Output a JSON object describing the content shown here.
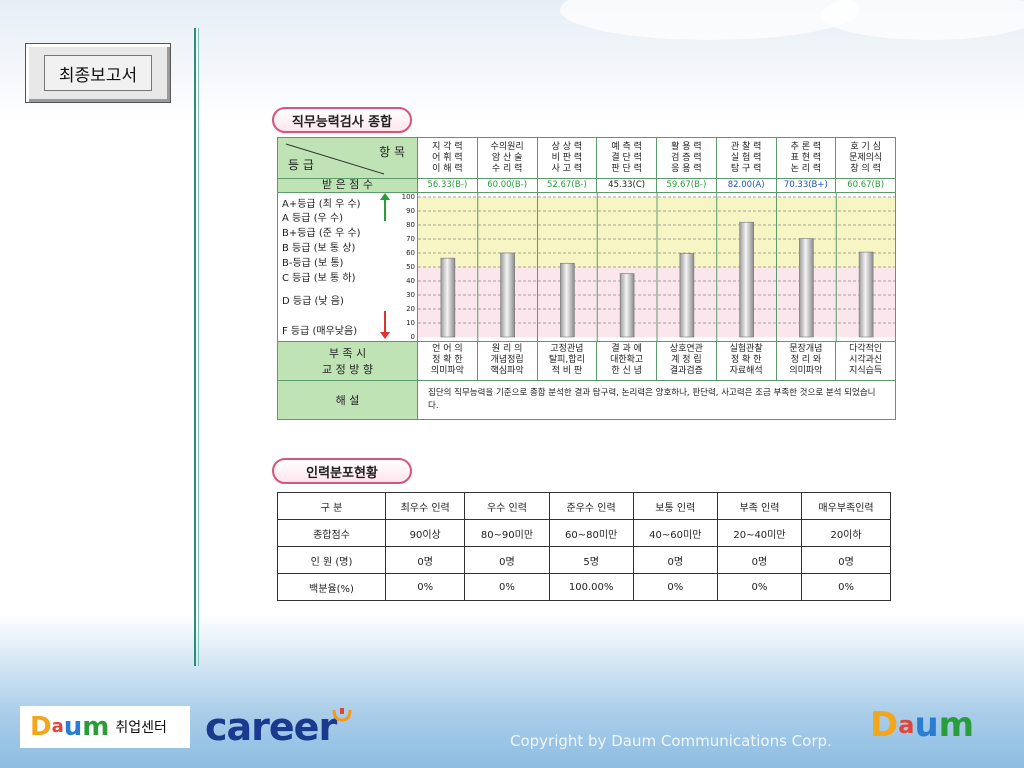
{
  "sidebar": {
    "report_button": "최종보고서"
  },
  "aptitude": {
    "title": "직무능력검사 종합",
    "header_item": "항 목",
    "header_grade": "등 급",
    "score_label": "받 은 점 수",
    "columns": [
      {
        "lines": [
          "지 각 력",
          "어 휘 력",
          "이 해 력"
        ],
        "score_text": "56.33(B-)",
        "score_color": "#2a9c3a",
        "value": 56.33
      },
      {
        "lines": [
          "수의원리",
          "암 산 술",
          "수 리 력"
        ],
        "score_text": "60.00(B-)",
        "score_color": "#2a9c3a",
        "value": 60.0
      },
      {
        "lines": [
          "상 상 력",
          "비 판 력",
          "사 고 력"
        ],
        "score_text": "52.67(B-)",
        "score_color": "#2a9c3a",
        "value": 52.67
      },
      {
        "lines": [
          "예 측 력",
          "결 단 력",
          "판 단 력"
        ],
        "score_text": "45.33(C)",
        "score_color": "#222222",
        "value": 45.33
      },
      {
        "lines": [
          "활 용 력",
          "검 증 력",
          "응 용 력"
        ],
        "score_text": "59.67(B-)",
        "score_color": "#2a9c3a",
        "value": 59.67
      },
      {
        "lines": [
          "관 찰 력",
          "실 험 력",
          "탐 구 력"
        ],
        "score_text": "82.00(A)",
        "score_color": "#1f4fbf",
        "value": 82.0
      },
      {
        "lines": [
          "추 론 력",
          "표 현 력",
          "논 리 력"
        ],
        "score_text": "70.33(B+)",
        "score_color": "#1f4fbf",
        "value": 70.33
      },
      {
        "lines": [
          "호 기 심",
          "문제의식",
          "창 의 력"
        ],
        "score_text": "60.67(B)",
        "score_color": "#2a9c3a",
        "value": 60.67
      }
    ],
    "grades": [
      {
        "label": "A+등급 (최 우 수)",
        "top": 2
      },
      {
        "label": "A 등급 (우     수)",
        "top": 16
      },
      {
        "label": "B+등급 (준 우 수)",
        "top": 31
      },
      {
        "label": "B 등급 (보 통 상)",
        "top": 46
      },
      {
        "label": "B-등급 (보     통)",
        "top": 61
      },
      {
        "label": "C 등급 (보 통 하)",
        "top": 76
      },
      {
        "label": "D 등급 (낮     음)",
        "top": 99
      },
      {
        "label": "F 등급 (매우낮음)",
        "top": 129
      }
    ],
    "ticks": [
      "100",
      "90",
      "80",
      "70",
      "60",
      "50",
      "40",
      "30",
      "20",
      "10",
      "0"
    ],
    "weakness": {
      "label_line1": "부   족   시",
      "label_line2": "교 정 방 향",
      "cells": [
        [
          "언 어 의",
          "정 확 한",
          "의미파악"
        ],
        [
          "원 리 의",
          "개념정립",
          "핵심파악"
        ],
        [
          "고정관념",
          "탈피,합리",
          "적 비 판"
        ],
        [
          "결 과 에",
          "대한확고",
          "한 신 념"
        ],
        [
          "상호연관",
          "계 정 립",
          "결과검증"
        ],
        [
          "실험관찰",
          "정 확 한",
          "자료해석"
        ],
        [
          "문장개념",
          "정 리 와",
          "의미파악"
        ],
        [
          "다각적인",
          "시각과신",
          "지식습득"
        ]
      ]
    },
    "commentary": {
      "label": "해          설",
      "text": "집단의 직무능력을 기준으로 종합 분석한 결과 탐구력, 논리력은 양호하나, 판단력, 사고력은 조금 부족한 것으로 분석 되었습니다."
    }
  },
  "chart_data": {
    "type": "bar",
    "categories": [
      "지각력·어휘력·이해력",
      "수의원리·암산술·수리력",
      "상상력·비판력·사고력",
      "예측력·결단력·판단력",
      "활용력·검증력·응용력",
      "관찰력·실험력·탐구력",
      "추론력·표현력·논리력",
      "호기심·문제의식·창의력"
    ],
    "values": [
      56.33,
      60.0,
      52.67,
      45.33,
      59.67,
      82.0,
      70.33,
      60.67
    ],
    "ylim": [
      0,
      100
    ],
    "grid": true,
    "bands": [
      {
        "from": 50,
        "to": 100,
        "color": "#f7f5c4"
      },
      {
        "from": 0,
        "to": 50,
        "color": "#fbe6ee"
      }
    ]
  },
  "distribution": {
    "title": "인력분포현황",
    "header": [
      "구  분",
      "최우수 인력",
      "우수 인력",
      "준우수 인력",
      "보통 인력",
      "부족 인력",
      "매우부족인력"
    ],
    "rows": [
      [
        "종합점수",
        "90이상",
        "80~90미만",
        "60~80미만",
        "40~60미만",
        "20~40미만",
        "20이하"
      ],
      [
        "인 원 (명)",
        "0명",
        "0명",
        "5명",
        "0명",
        "0명",
        "0명"
      ],
      [
        "백분율(%)",
        "0%",
        "0%",
        "100.00%",
        "0%",
        "0%",
        "0%"
      ]
    ]
  },
  "footer": {
    "daum_logo": [
      "D",
      "a",
      "u",
      "m"
    ],
    "service_name": "취업센터",
    "career_logo": "career",
    "copyright": "Copyright by Daum Communications Corp."
  }
}
